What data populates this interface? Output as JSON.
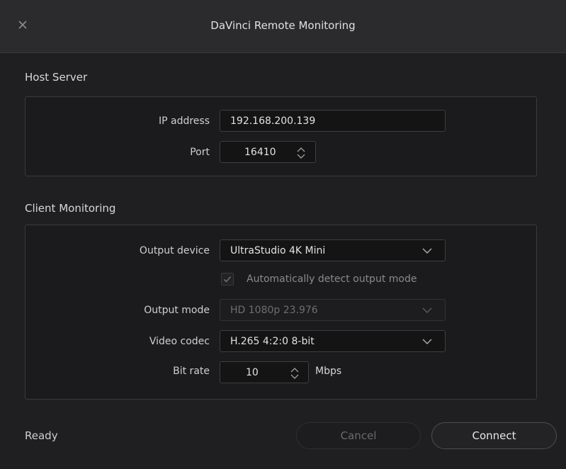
{
  "window": {
    "title": "DaVinci Remote Monitoring"
  },
  "host_server": {
    "title": "Host Server",
    "ip_label": "IP address",
    "ip_value": "192.168.200.139",
    "port_label": "Port",
    "port_value": "16410"
  },
  "client_monitoring": {
    "title": "Client Monitoring",
    "output_device_label": "Output device",
    "output_device_value": "UltraStudio 4K Mini",
    "auto_detect_label": "Automatically detect output mode",
    "auto_detect_checked": true,
    "output_mode_label": "Output mode",
    "output_mode_value": "HD 1080p 23.976",
    "video_codec_label": "Video codec",
    "video_codec_value": "H.265 4:2:0 8-bit",
    "bit_rate_label": "Bit rate",
    "bit_rate_value": "10",
    "bit_rate_unit": "Mbps"
  },
  "footer": {
    "status": "Ready",
    "cancel_label": "Cancel",
    "connect_label": "Connect"
  },
  "icons": {
    "close": "close-icon",
    "dropdown": "chevron-down-icon",
    "spinner": "spinner-arrows-icon",
    "check": "checkmark-icon"
  }
}
